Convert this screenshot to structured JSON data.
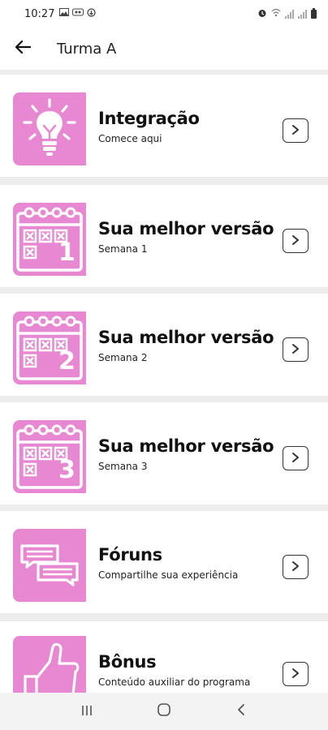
{
  "status_bar": {
    "time": "10:27",
    "left_icons": [
      "image-icon",
      "nfc-icon",
      "sync-icon"
    ],
    "right_icons": [
      "alarm-icon",
      "wifi-icon",
      "signal-icon",
      "signal-icon",
      "battery-icon"
    ]
  },
  "app_bar": {
    "title": "Turma A",
    "back_icon": "arrow-left-icon"
  },
  "cards": [
    {
      "title": "Integração",
      "subtitle": "Comece aqui",
      "icon": "lightbulb-icon"
    },
    {
      "title": "Sua melhor versão",
      "subtitle": "Semana 1",
      "icon": "calendar-week-icon",
      "badge": "1"
    },
    {
      "title": "Sua melhor versão",
      "subtitle": "Semana 2",
      "icon": "calendar-week-icon",
      "badge": "2"
    },
    {
      "title": "Sua melhor versão",
      "subtitle": "Semana 3",
      "icon": "calendar-week-icon",
      "badge": "3"
    },
    {
      "title": "Fóruns",
      "subtitle": "Compartilhe sua experiência",
      "icon": "chat-bubbles-icon"
    },
    {
      "title": "Bônus",
      "subtitle": "Conteúdo auxiliar do programa",
      "icon": "thumbs-up-icon"
    }
  ],
  "nav_bar": {
    "buttons": [
      "recent-apps-icon",
      "home-icon",
      "back-icon"
    ]
  },
  "colors": {
    "accent": "#e888d2",
    "card_background": "#ffffff",
    "page_background": "#ececec"
  }
}
